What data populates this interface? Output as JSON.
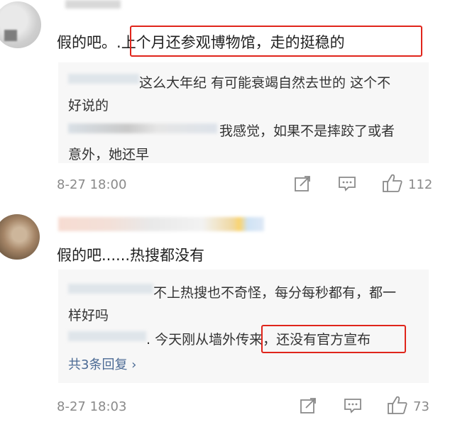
{
  "comments": [
    {
      "text_pre": "假的吧。.",
      "text_highlight": "上个月还参观博物馆，走的挺稳的",
      "replies": [
        {
          "line1": "这么大年纪 有可能衰竭自然去世的 这个不",
          "line2": "好说的"
        },
        {
          "line1": "我感觉，如果不是摔跤了或者",
          "line2": "意外，她还早"
        }
      ],
      "time": "8-27 18:00",
      "likes": "112"
    },
    {
      "text": "假的吧......热搜都没有",
      "replies": [
        {
          "line1": "不上热搜也不奇怪，每分每秒都有，都一",
          "line2": "样好吗"
        },
        {
          "pre": ". 今天刚从墙外传",
          "highlight": "来，还没有官方宣布"
        }
      ],
      "more": "共3条回复 ›",
      "time": "8-27 18:03",
      "likes": "73"
    }
  ],
  "colors": {
    "highlight": "#e0251b",
    "link": "#4b6a94",
    "meta": "#8a8a8a",
    "reply_bg": "#f7f7f7"
  },
  "icons": [
    "share-icon",
    "comment-icon",
    "like-icon"
  ]
}
